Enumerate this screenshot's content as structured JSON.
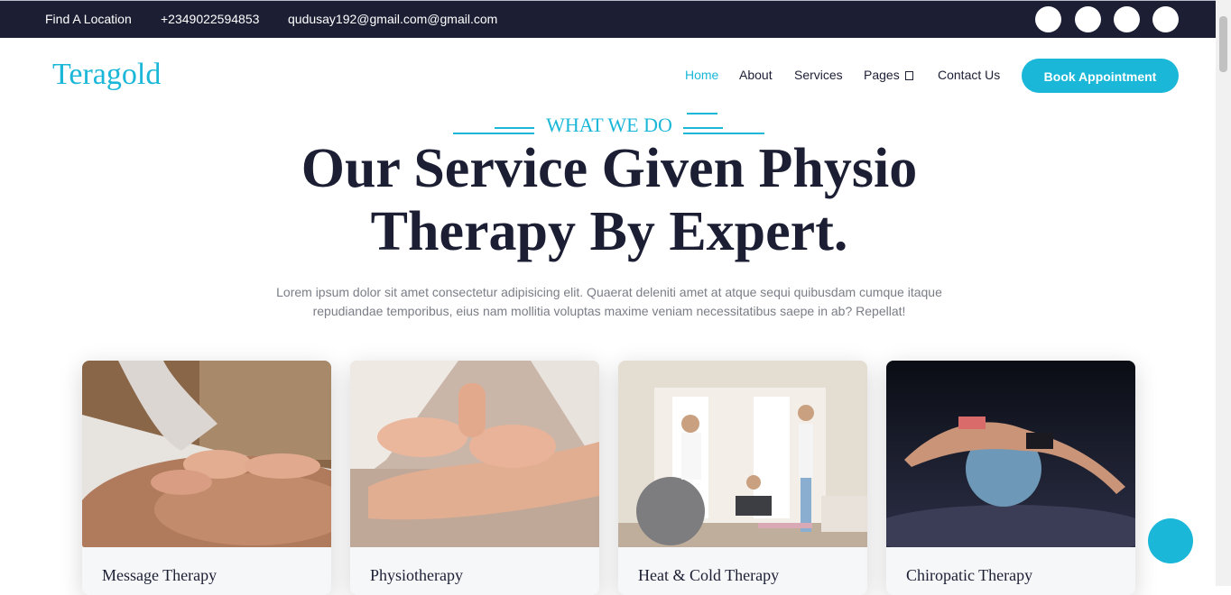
{
  "topbar": {
    "location": "Find A Location",
    "phone": "+2349022594853",
    "email": "qudusay192@gmail.com@gmail.com"
  },
  "header": {
    "logo": "Teragold",
    "nav": [
      "Home",
      "About",
      "Services",
      "Pages",
      "Contact Us"
    ],
    "active_nav": "Home",
    "book_button": "Book Appointment"
  },
  "section": {
    "eyebrow": "WHAT WE DO",
    "headline": "Our Service Given Physio Therapy By Expert.",
    "intro": "Lorem ipsum dolor sit amet consectetur adipisicing elit. Quaerat deleniti amet at atque sequi quibusdam cumque itaque repudiandae temporibus, eius nam mollitia voluptas maxime veniam necessitatibus saepe in ab? Repellat!"
  },
  "cards": [
    {
      "title": "Message Therapy",
      "image": "back-massage-photo"
    },
    {
      "title": "Physiotherapy",
      "image": "leg-massage-photo"
    },
    {
      "title": "Heat & Cold Therapy",
      "image": "women-exercise-ball-photo"
    },
    {
      "title": "Chiropatic Therapy",
      "image": "stretch-on-ball-photo"
    }
  ],
  "colors": {
    "accent": "#1ab7d8",
    "dark": "#1c1f34",
    "muted_text": "#7a7d86"
  },
  "icons": [
    "facebook-icon",
    "twitter-icon",
    "instagram-icon",
    "linkedin-icon",
    "chevron-down-icon",
    "chat-icon"
  ]
}
